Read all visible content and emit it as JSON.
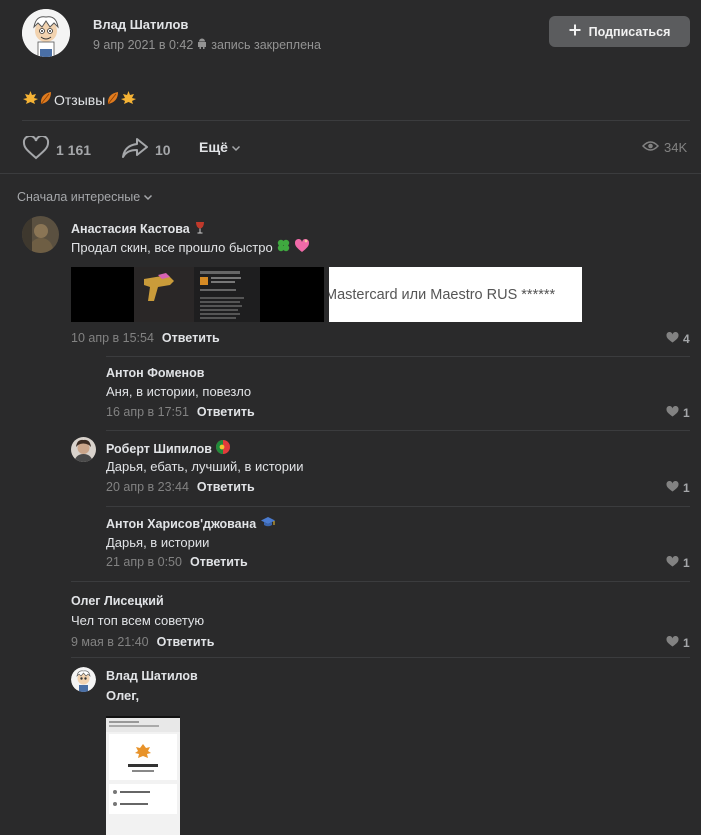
{
  "post": {
    "author": "Влад Шатилов",
    "date": "9 апр 2021 в 0:42",
    "pinned": "запись закреплена",
    "subscribe_label": "Подписаться",
    "text": "Отзывы",
    "likes": "1 161",
    "shares": "10",
    "more_label": "Ещё",
    "views": "34K"
  },
  "comments_sort": "Сначала интересные",
  "comments": [
    {
      "author": "Анастасия Кастова",
      "text": "Продал скин, все прошло быстро",
      "date": "10 апр в 15:54",
      "reply": "Ответить",
      "likes": "4"
    },
    {
      "author": "Антон Фоменов",
      "text": "Аня, в истории, повезло",
      "date": "16 апр в 17:51",
      "reply": "Ответить",
      "likes": "1"
    },
    {
      "author": "Роберт Шипилов",
      "text": "Дарья, ебать, лучший, в истории",
      "date": "20 апр в 23:44",
      "reply": "Ответить",
      "likes": "1"
    },
    {
      "author": "Антон Харисов'джована",
      "text": "Дарья, в истории",
      "date": "21 апр в 0:50",
      "reply": "Ответить",
      "likes": "1"
    },
    {
      "author": "Олег Лисецкий",
      "text": "Чел топ всем советую",
      "date": "9 мая в 21:40",
      "reply": "Ответить",
      "likes": "1"
    },
    {
      "author": "Влад Шатилов",
      "text": "Олег,"
    }
  ],
  "attachments": {
    "payment_text": "Mastercard или Maestro RUS ******"
  },
  "colors": {
    "background": "#2a2a2b",
    "divider": "#3b3c3e",
    "text_primary": "#e1e3e6",
    "text_secondary": "#828282",
    "button": "#5b5c5e"
  }
}
